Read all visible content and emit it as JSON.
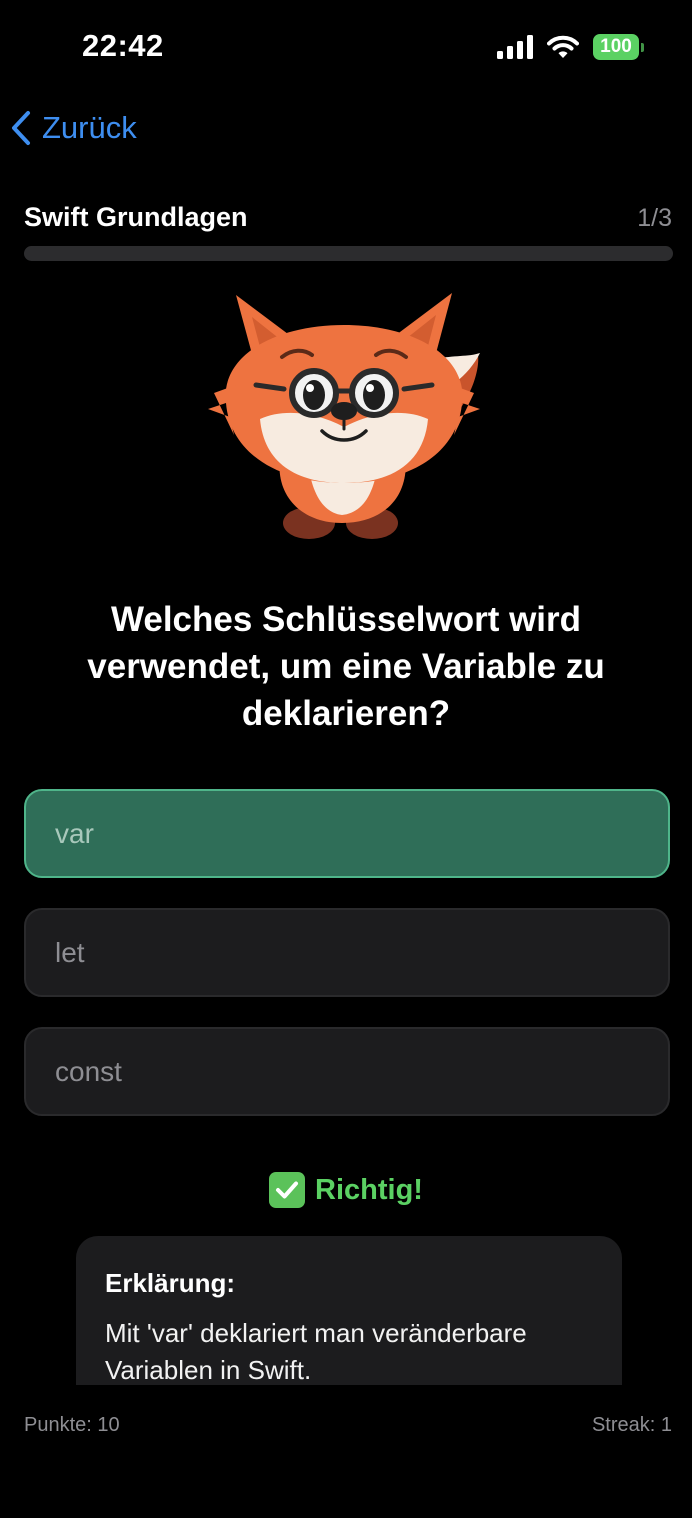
{
  "status_bar": {
    "time": "22:42",
    "battery": "100",
    "icons": [
      "signal-icon",
      "wifi-icon",
      "battery-icon"
    ]
  },
  "nav": {
    "back_label": "Zurück",
    "back_icon": "chevron-left-icon"
  },
  "quiz": {
    "title": "Swift Grundlagen",
    "progress_text": "1/3",
    "progress_fraction": 0.0
  },
  "mascot": {
    "icon": "fox-mascot-icon"
  },
  "question": {
    "text": "Welches Schlüsselwort wird verwendet, um eine Variable zu deklarieren?"
  },
  "answers": [
    {
      "label": "var",
      "state": "correct"
    },
    {
      "label": "let",
      "state": "default"
    },
    {
      "label": "const",
      "state": "default"
    }
  ],
  "feedback": {
    "icon": "check-mark-icon",
    "text": "Richtig!"
  },
  "explanation": {
    "title": "Erklärung:",
    "body": "Mit 'var' deklariert man veränderbare Variablen in Swift."
  },
  "footer": {
    "points": "Punkte: 10",
    "streak": "Streak: 1"
  },
  "colors": {
    "accent": "#3e8ef0",
    "success": "#5bd163",
    "correct_bg": "#2f6e58",
    "card_bg": "#1c1c1e"
  }
}
